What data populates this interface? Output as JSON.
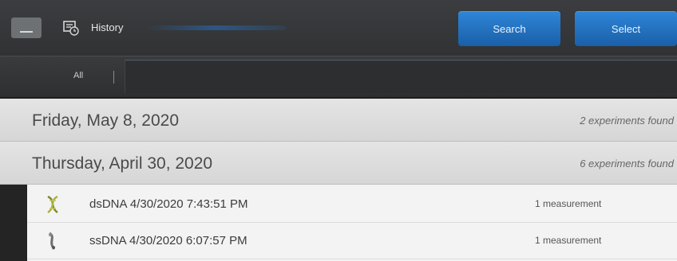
{
  "header": {
    "title": "History",
    "search_label": "Search",
    "select_label": "Select"
  },
  "filter": {
    "tab_label": "All"
  },
  "groups": [
    {
      "date": "Friday, May 8, 2020",
      "count": "2 experiments found",
      "items": []
    },
    {
      "date": "Thursday, April 30, 2020",
      "count": "6 experiments found",
      "items": [
        {
          "name": "dsDNA 4/30/2020 7:43:51 PM",
          "meta": "1 measurement",
          "icon": "dsdna-icon"
        },
        {
          "name": "ssDNA 4/30/2020 6:07:57 PM",
          "meta": "1 measurement",
          "icon": "ssdna-icon"
        }
      ]
    }
  ],
  "colors": {
    "accent": "#2277c9",
    "toolbar": "#35373a",
    "header_bg": "#dedede"
  }
}
